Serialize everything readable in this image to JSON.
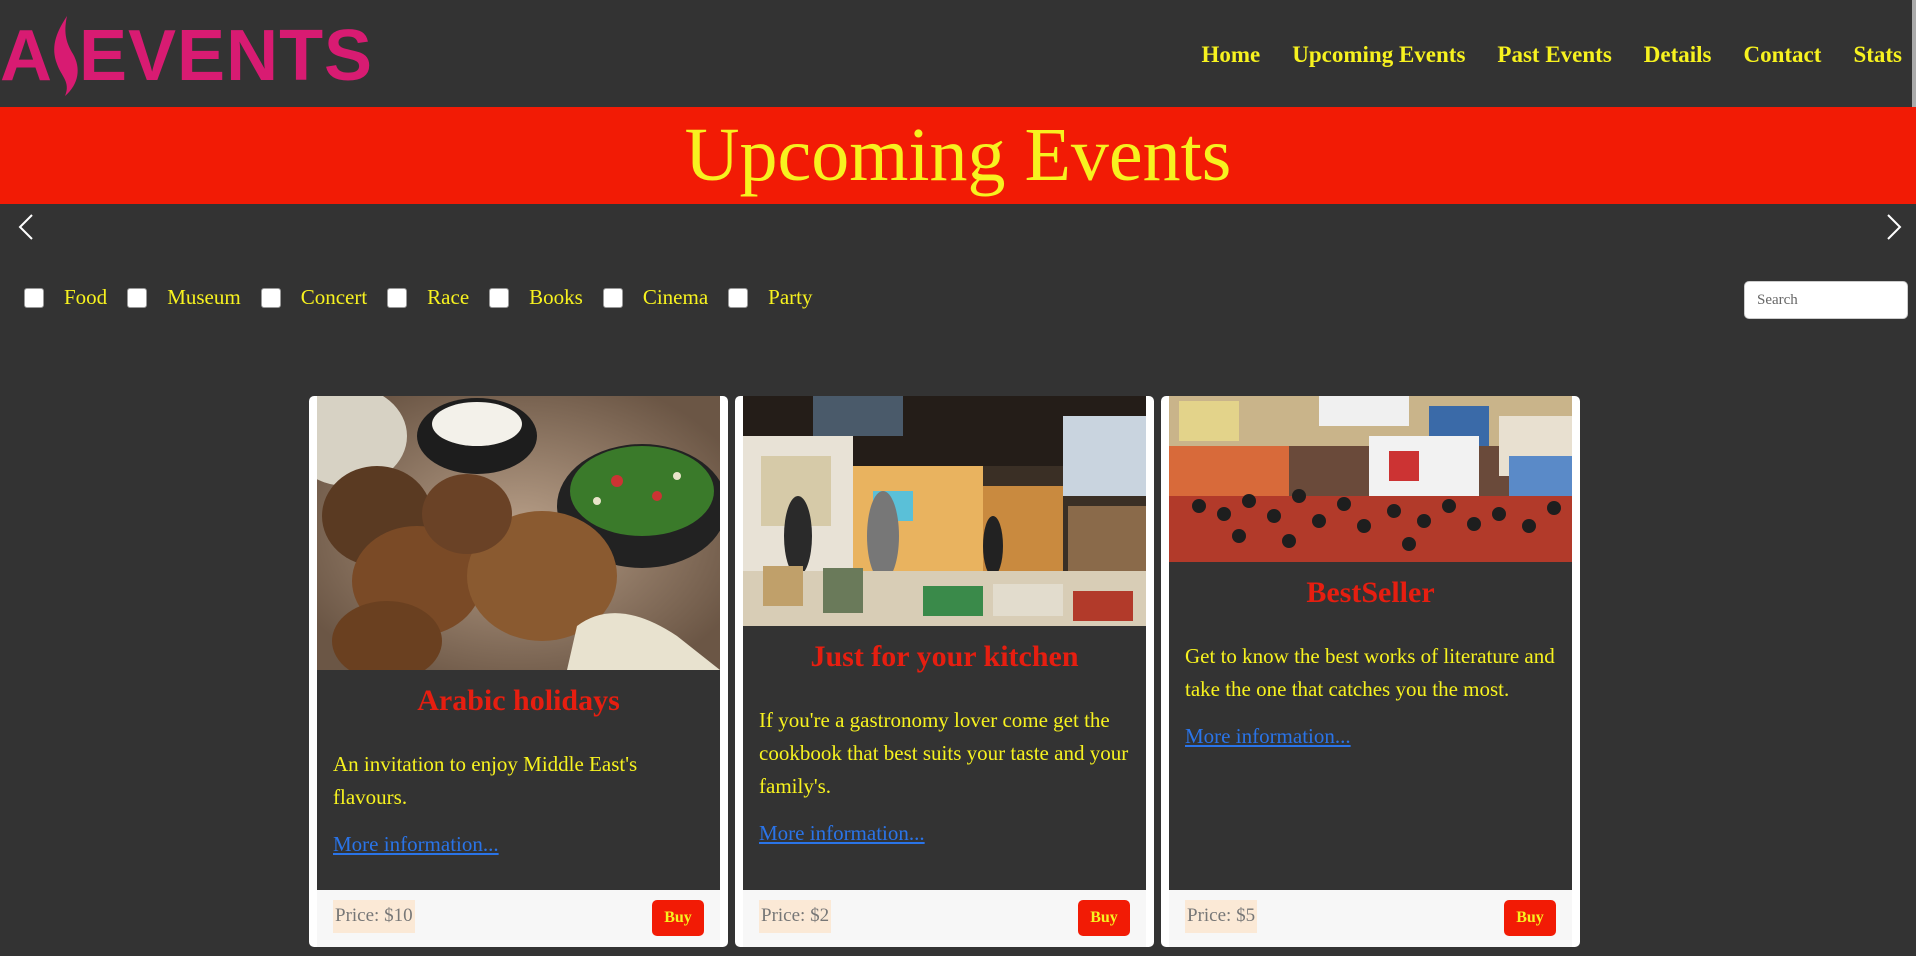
{
  "brand": {
    "logo_left": "A",
    "logo_right": "EVENTS",
    "color": "#d81b72"
  },
  "nav": {
    "items": [
      {
        "label": "Home"
      },
      {
        "label": "Upcoming Events"
      },
      {
        "label": "Past Events"
      },
      {
        "label": "Details"
      },
      {
        "label": "Contact"
      },
      {
        "label": "Stats"
      }
    ]
  },
  "banner": {
    "title": "Upcoming Events",
    "bg": "#f21b05",
    "text_color": "#f7f21f"
  },
  "carousel": {
    "prev_icon": "chevron-left-icon",
    "next_icon": "chevron-right-icon"
  },
  "filters": {
    "categories": [
      {
        "label": "Food",
        "checked": false
      },
      {
        "label": "Museum",
        "checked": false
      },
      {
        "label": "Concert",
        "checked": false
      },
      {
        "label": "Race",
        "checked": false
      },
      {
        "label": "Books",
        "checked": false
      },
      {
        "label": "Cinema",
        "checked": false
      },
      {
        "label": "Party",
        "checked": false
      }
    ]
  },
  "search": {
    "placeholder": "Search",
    "value": ""
  },
  "events": [
    {
      "title": "Arabic holidays",
      "description": "An invitation to enjoy Middle East's flavours.",
      "link": "More information...",
      "price": "Price: $10",
      "buy_label": "Buy",
      "image": "falafel-food-photo"
    },
    {
      "title": "Just for your kitchen",
      "description": "If you're a gastronomy lover come get the cookbook that best suits your taste and your family's.",
      "link": "More information...",
      "price": "Price: $2",
      "buy_label": "Buy",
      "image": "book-fair-stand-photo"
    },
    {
      "title": "BestSeller",
      "description": "Get to know the best works of literature and take the one that catches you the most.",
      "link": "More information...",
      "price": "Price: $5",
      "buy_label": "Buy",
      "image": "book-fair-crowd-photo"
    }
  ]
}
